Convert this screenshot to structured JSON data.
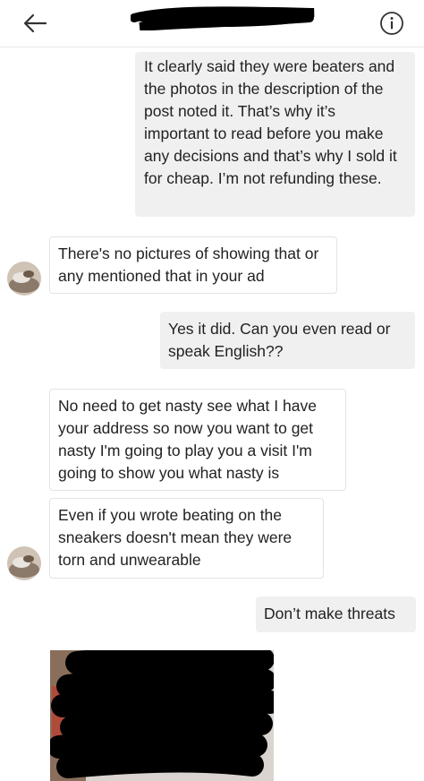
{
  "header": {
    "back_icon": "arrow-left-icon",
    "info_icon": "info-circle-icon",
    "title_redacted": true
  },
  "messages": [
    {
      "direction": "outgoing",
      "text": "It clearly said they were beaters and the photos in the description of the post noted it. That’s why it’s important to read before you make any decisions and that’s why I sold it for cheap. I’m not refunding these."
    },
    {
      "direction": "incoming",
      "text": "There's no pictures of showing that or any mentioned that in your ad"
    },
    {
      "direction": "outgoing",
      "text": "Yes it did. Can you even read or speak English??"
    },
    {
      "direction": "incoming",
      "text": "No need to get nasty see what I have your address so now you want to get nasty I'm going to play you a visit I'm going to show you what nasty is"
    },
    {
      "direction": "incoming",
      "text": "Even if you wrote beating on the sneakers doesn't mean they were torn and unwearable"
    },
    {
      "direction": "outgoing",
      "text": "Don’t make threats"
    }
  ],
  "attachment": {
    "type": "photo",
    "redacted": true
  }
}
